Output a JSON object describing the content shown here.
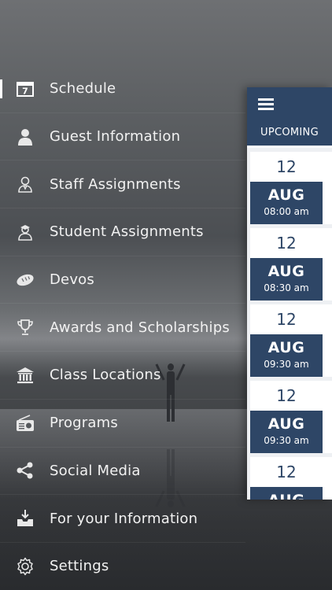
{
  "menu": {
    "items": [
      {
        "label": "Schedule",
        "icon": "calendar-icon",
        "active": true
      },
      {
        "label": "Guest Information",
        "icon": "person-icon"
      },
      {
        "label": "Staff Assignments",
        "icon": "staff-person-icon"
      },
      {
        "label": "Student Assignments",
        "icon": "student-person-icon"
      },
      {
        "label": "Devos",
        "icon": "bread-icon"
      },
      {
        "label": "Awards and Scholarships",
        "icon": "trophy-icon"
      },
      {
        "label": "Class Locations",
        "icon": "building-icon"
      },
      {
        "label": "Programs",
        "icon": "radio-icon"
      },
      {
        "label": "Social Media",
        "icon": "share-icon"
      },
      {
        "label": "For your Information",
        "icon": "inbox-icon"
      },
      {
        "label": "Settings",
        "icon": "gear-icon"
      }
    ],
    "calendar_icon_text": "7"
  },
  "panel": {
    "menu_icon": "hamburger-icon",
    "tab_label": "UPCOMING",
    "events": [
      {
        "day": "12",
        "month": "AUG",
        "time": "08:00 am"
      },
      {
        "day": "12",
        "month": "AUG",
        "time": "08:30 am"
      },
      {
        "day": "12",
        "month": "AUG",
        "time": "09:30 am"
      },
      {
        "day": "12",
        "month": "AUG",
        "time": "09:30 am"
      },
      {
        "day": "12",
        "month": "AUG",
        "time": ""
      }
    ]
  },
  "colors": {
    "panel_blue": "#2e4666",
    "text": "#f2f2f2"
  }
}
